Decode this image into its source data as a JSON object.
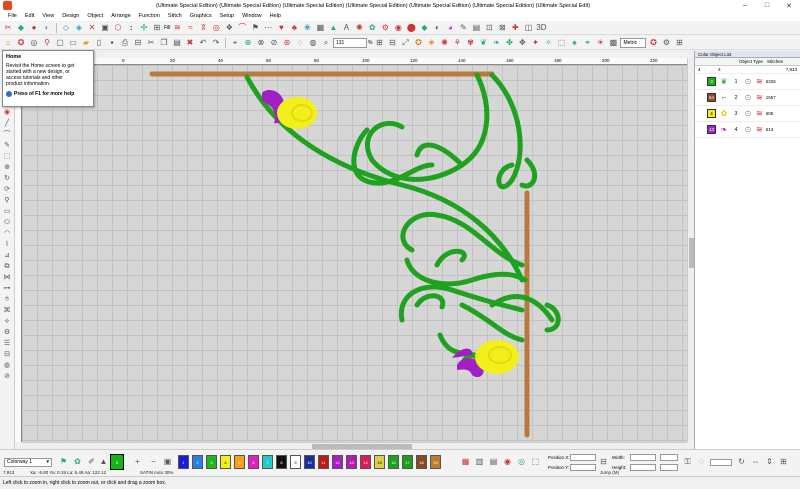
{
  "window": {
    "title": "(Ultimate Special Edition) (Ultimate Special Edition) (Ultimate Special Edition) (Ultimate Special Edition) (Ultimate Special Edition) (Ultimate Special Edition) (Ultimate Special Edit)"
  },
  "menu": [
    "File",
    "Edit",
    "View",
    "Design",
    "Object",
    "Arrange",
    "Function",
    "Stitch",
    "Graphics",
    "Setup",
    "Window",
    "Help"
  ],
  "toolbar": {
    "zoom_value": "131",
    "zoom_unit": "%",
    "units_value": "Metric",
    "fill_label": "Fill"
  },
  "tooltip": {
    "title": "Home",
    "body": "Revisit the Home screen to get started with a new design, or access tutorials and other product information.",
    "help": "Press of F1 for more help"
  },
  "ruler": {
    "h_ticks": [
      "-40",
      "-20",
      "0",
      "20",
      "40",
      "60",
      "80",
      "100",
      "120",
      "140",
      "160",
      "180",
      "200",
      "220",
      "240"
    ]
  },
  "panel": {
    "tab": "Color Object List",
    "col_object_type": "Object Type",
    "col_stitches": "Stitches",
    "total_left": "4",
    "total_mid": "4",
    "total_stitches": "7,913",
    "items": [
      {
        "swatch": "3",
        "color": "#15b515",
        "num": "1",
        "stitches": "5326"
      },
      {
        "swatch": "54",
        "color": "#8a4b1e",
        "num": "2",
        "stitches": "1557"
      },
      {
        "swatch": "4",
        "color": "#f2ee1b",
        "num": "3",
        "stitches": "605"
      },
      {
        "swatch": "13",
        "color": "#a321c4",
        "num": "4",
        "stitches": "513"
      }
    ]
  },
  "bottom": {
    "colorway": "Colorway 1",
    "position_x": "Position X:",
    "position_y": "Position Y:",
    "width": "Width:",
    "height": "Height:",
    "chips": [
      {
        "n": "1",
        "c": "#1b1be0"
      },
      {
        "n": "2",
        "c": "#2a7fe0"
      },
      {
        "n": "3",
        "c": "#1eb81e"
      },
      {
        "n": "4",
        "c": "#f2ee1b"
      },
      {
        "n": "5",
        "c": "#f5a11a"
      },
      {
        "n": "6",
        "c": "#e31ec0"
      },
      {
        "n": "7",
        "c": "#25c9c9"
      },
      {
        "n": "8",
        "c": "#111111"
      },
      {
        "n": "9",
        "c": "#ffffff"
      },
      {
        "n": "10",
        "c": "#1c2c9c"
      },
      {
        "n": "11",
        "c": "#c01818"
      },
      {
        "n": "12",
        "c": "#a71ec4"
      },
      {
        "n": "13",
        "c": "#b51bb0"
      },
      {
        "n": "14",
        "c": "#dd1b5b"
      },
      {
        "n": "15",
        "c": "#d8d04a"
      },
      {
        "n": "16",
        "c": "#1ba31b"
      },
      {
        "n": "17",
        "c": "#1b9f1b"
      },
      {
        "n": "18",
        "c": "#8a4b1e"
      },
      {
        "n": "19",
        "c": "#bf7b2a"
      }
    ]
  },
  "info": {
    "stitches": "7,913",
    "coords": "Xa: -5.80 Ya: 0.19 La: 6.49 Aa: 122.12",
    "satin": "SATIN Auto 30%",
    "jump": "Jump (M)"
  },
  "status": {
    "hint": "Left click to zoom in, right click to zoom out, or click and drag a zoom box."
  },
  "colors": {
    "green": "#1fa21f",
    "brown": "#b87a3f",
    "yellow": "#f3ef1a",
    "purple": "#a11fc3",
    "canvas": "#d6d6d6"
  }
}
